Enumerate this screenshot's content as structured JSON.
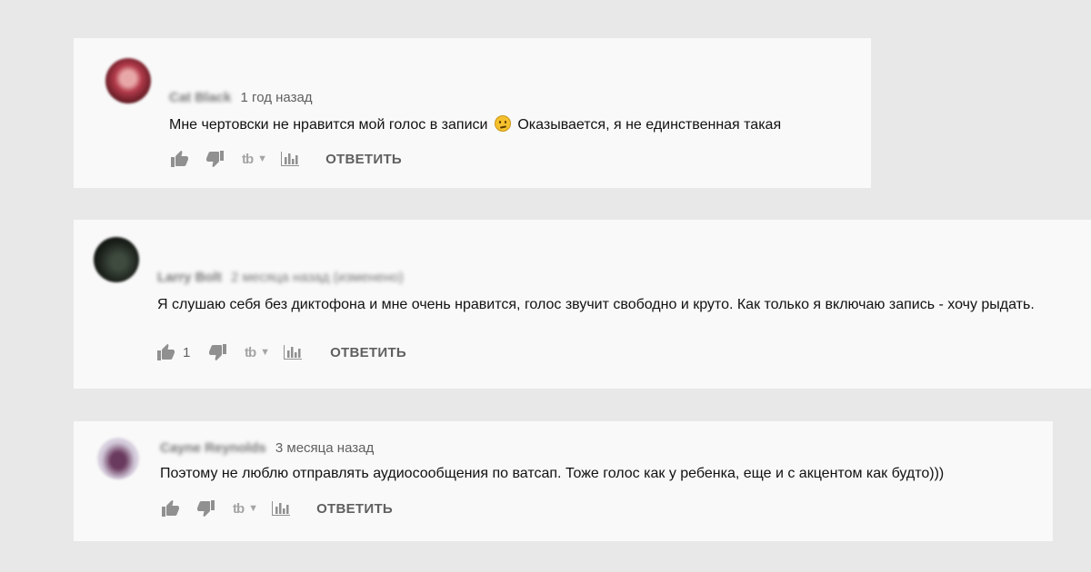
{
  "comments": [
    {
      "author": "Cat Black",
      "time": "1 год назад",
      "edited": "",
      "text": "Мне чертовски не нравится мой голос в записи",
      "text_after_emoji": "Оказывается, я не единственная такая",
      "emoji": "confused-face",
      "like_count": "",
      "actions": {
        "donate": "tb",
        "reply": "ОТВЕТИТЬ"
      }
    },
    {
      "author": "Larry Bolt",
      "time": "2 месяца назад",
      "edited": "(изменено)",
      "text": "Я слушаю себя без диктофона и мне очень нравится, голос звучит свободно и круто. Как только я включаю запись - хочу рыдать.",
      "like_count": "1",
      "actions": {
        "donate": "tb",
        "reply": "ОТВЕТИТЬ"
      }
    },
    {
      "author": "Cayne Reynolds",
      "time": "3 месяца назад",
      "edited": "",
      "text": "Поэтому не люблю отправлять аудиосообщения по ватсап. Тоже голос как у ребенка, еще и с акцентом как будто)))",
      "like_count": "",
      "actions": {
        "donate": "tb",
        "reply": "ОТВЕТИТЬ"
      }
    }
  ],
  "colors": {
    "page_background": "#e8e8e8",
    "card_background": "#f9f9f9",
    "secondary_text": "#606060",
    "icon_gray": "#909090"
  }
}
